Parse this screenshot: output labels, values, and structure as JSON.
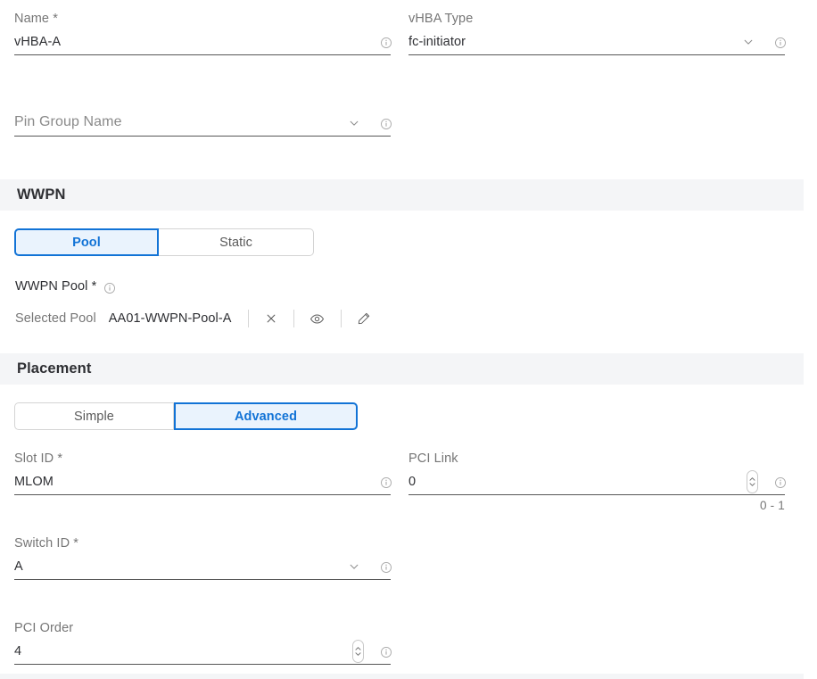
{
  "form": {
    "name": {
      "label": "Name *",
      "value": "vHBA-A",
      "info_icon": "info-circle-icon"
    },
    "vhba_type": {
      "label": "vHBA Type",
      "value": "fc-initiator",
      "chevron_icon": "chevron-down-icon",
      "info_icon": "info-circle-icon"
    },
    "pin_group_name": {
      "label": "",
      "placeholder": "Pin Group Name",
      "value": "",
      "chevron_icon": "chevron-down-icon",
      "info_icon": "info-circle-icon"
    }
  },
  "wwpn": {
    "section_title": "WWPN",
    "tabs": [
      {
        "label": "Pool",
        "active": true
      },
      {
        "label": "Static",
        "active": false
      }
    ],
    "pool_label": "WWPN Pool *",
    "pool_label_info_icon": "info-circle-icon",
    "selected_pool_label": "Selected Pool",
    "selected_pool_value": "AA01-WWPN-Pool-A",
    "actions": [
      {
        "name": "clear-pool-button",
        "icon": "close-x-icon"
      },
      {
        "name": "view-pool-button",
        "icon": "eye-icon"
      },
      {
        "name": "edit-pool-button",
        "icon": "pencil-icon"
      }
    ]
  },
  "placement": {
    "section_title": "Placement",
    "tabs": [
      {
        "label": "Simple",
        "active": false
      },
      {
        "label": "Advanced",
        "active": true
      }
    ],
    "slot_id": {
      "label": "Slot ID *",
      "value": "MLOM",
      "info_icon": "info-circle-icon"
    },
    "pci_link": {
      "label": "PCI Link",
      "value": "0",
      "helper": "0 - 1",
      "spinner_icon": "stepper-up-down-icon",
      "info_icon": "info-circle-icon"
    },
    "switch_id": {
      "label": "Switch ID *",
      "value": "A",
      "chevron_icon": "chevron-down-icon",
      "info_icon": "info-circle-icon"
    },
    "pci_order": {
      "label": "PCI Order",
      "value": "4",
      "spinner_icon": "stepper-up-down-icon",
      "info_icon": "info-circle-icon"
    }
  },
  "colors": {
    "accent": "#1273d6",
    "accent_fill": "#eaf3fd",
    "section_band": "#f4f5f7",
    "underline": "#565656",
    "label": "#767676",
    "text": "#2e2f33"
  }
}
